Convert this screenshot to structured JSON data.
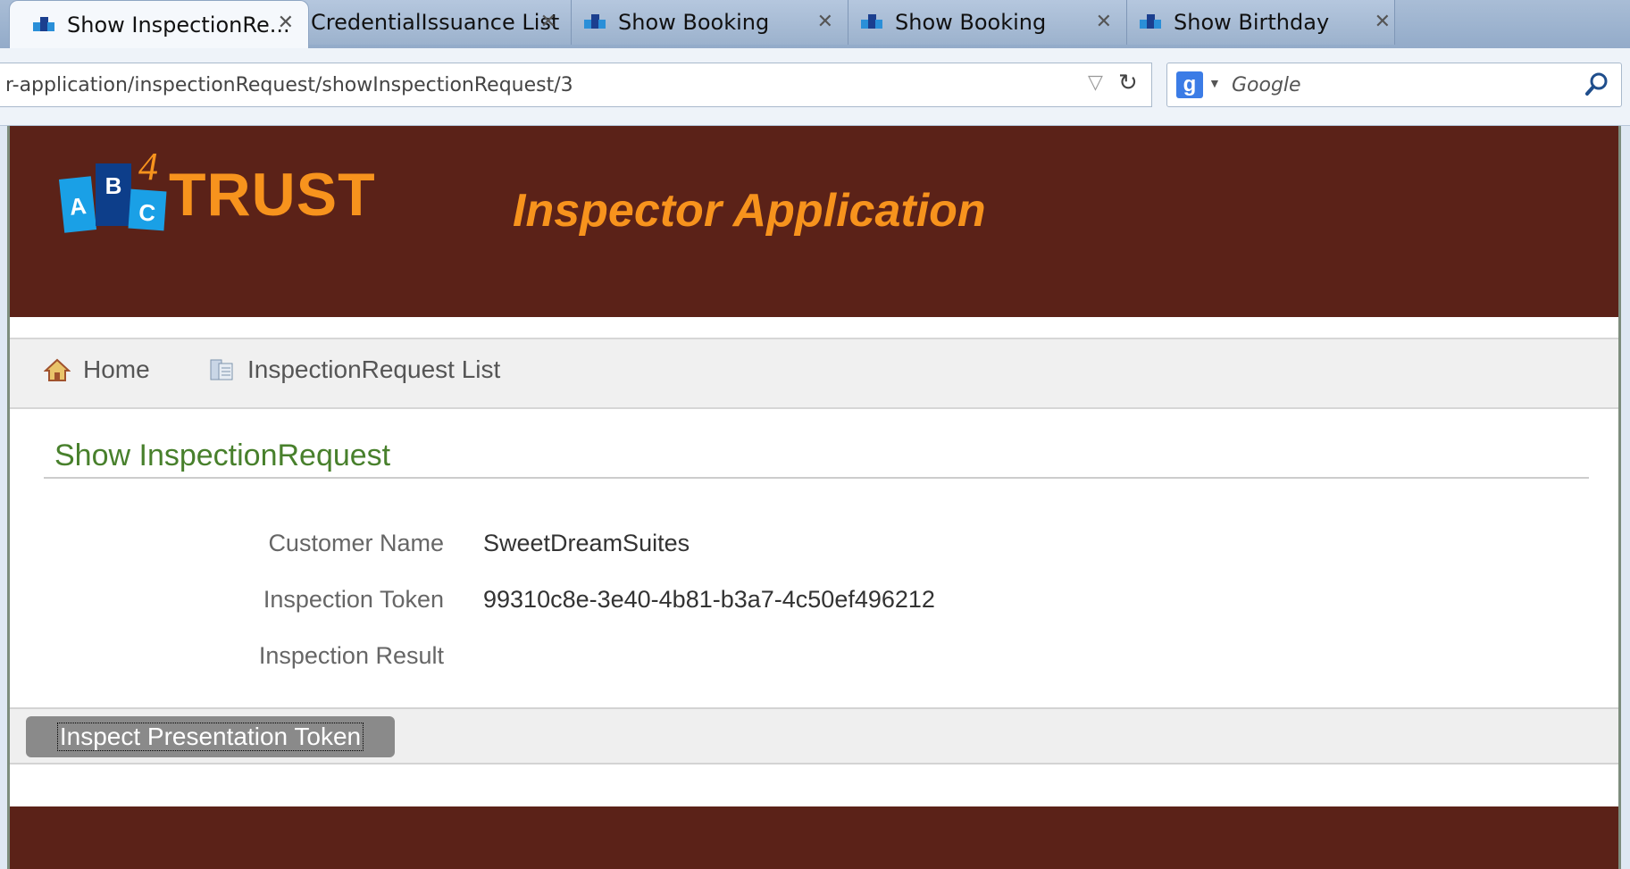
{
  "browser": {
    "tabs": [
      {
        "label": "Show InspectionRe...",
        "active": true,
        "has_icon": true
      },
      {
        "label": "CredentialIssuance List",
        "active": false,
        "has_icon": false
      },
      {
        "label": "Show Booking",
        "active": false,
        "has_icon": true
      },
      {
        "label": "Show Booking",
        "active": false,
        "has_icon": true
      },
      {
        "label": "Show Birthday",
        "active": false,
        "has_icon": true
      }
    ],
    "close_glyph": "✕",
    "url": "r-application/inspectionRequest/showInspectionRequest/3",
    "search_engine_letter": "g",
    "search_placeholder": "Google"
  },
  "header": {
    "logo_letters": [
      "A",
      "B",
      "C"
    ],
    "logo_four": "4",
    "logo_word": "TRUST",
    "app_title": "Inspector Application"
  },
  "nav": {
    "home_label": "Home",
    "list_label": "InspectionRequest List"
  },
  "content": {
    "title": "Show InspectionRequest",
    "properties": [
      {
        "label": "Customer Name",
        "value": "SweetDreamSuites"
      },
      {
        "label": "Inspection Token",
        "value": "99310c8e-3e40-4b81-b3a7-4c50ef496212"
      },
      {
        "label": "Inspection Result",
        "value": ""
      }
    ],
    "button_label": "Inspect Presentation Token"
  },
  "colors": {
    "header_bg": "#5b2218",
    "accent_orange": "#f7931d",
    "title_green": "#48802c"
  },
  "icons": {
    "home": "home-icon",
    "list": "list-icon",
    "favicon": "abc4trust-favicon-icon"
  }
}
